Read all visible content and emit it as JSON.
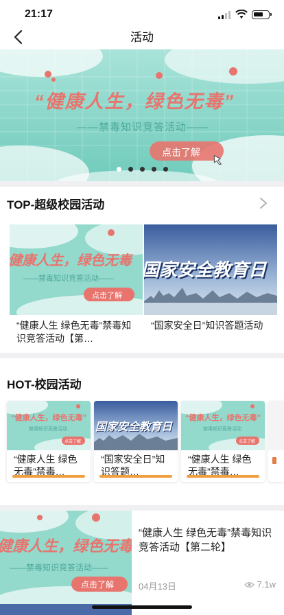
{
  "status": {
    "time": "21:17"
  },
  "nav": {
    "title": "活动"
  },
  "banner": {
    "headline": "“健康人生，绿色无毒”",
    "subline": "——禁毒知识竞答活动——",
    "button": "点击了解",
    "dots": 5,
    "active_dot": 0
  },
  "top_section": {
    "title": "TOP-超级校园活动",
    "cards": [
      {
        "caption": "“健康人生 绿色无毒”禁毒知识竞答活动【第…",
        "img_text": "健康人生，绿色无毒",
        "img_sub": "——禁毒知识竞答活动——",
        "img_btn": "点击了解"
      },
      {
        "caption": "“国家安全日”知识答题活动",
        "img_text": "国家安全教育日"
      }
    ]
  },
  "hot_section": {
    "title": "HOT-校园活动",
    "cards": [
      {
        "caption": "“健康人生 绿色无毒”禁毒…",
        "img_text": "“健康人生，绿色无毒”",
        "img_sub": "禁毒知识竞答活动",
        "img_btn": "点击了解"
      },
      {
        "caption": "“国家安全日”知识答题…",
        "img_text": "国家安全教育日"
      },
      {
        "caption": "“健康人生 绿色无毒”禁毒…",
        "img_text": "“健康人生，绿色无毒”",
        "img_sub": "禁毒知识竞答活动",
        "img_btn": "点击了解"
      }
    ]
  },
  "feed": {
    "caption": "“健康人生 绿色无毒”禁毒知识竞答活动【第二轮】",
    "img_text": "健康人生，绿色无毒",
    "img_sub": "——禁毒知识竞答活动——",
    "img_btn": "点击了解",
    "date": "04月13日",
    "views": "7.1w"
  },
  "colors": {
    "teal": "#7fd3c4",
    "title_red": "#e8746e",
    "accent_orange": "#f0a040"
  }
}
